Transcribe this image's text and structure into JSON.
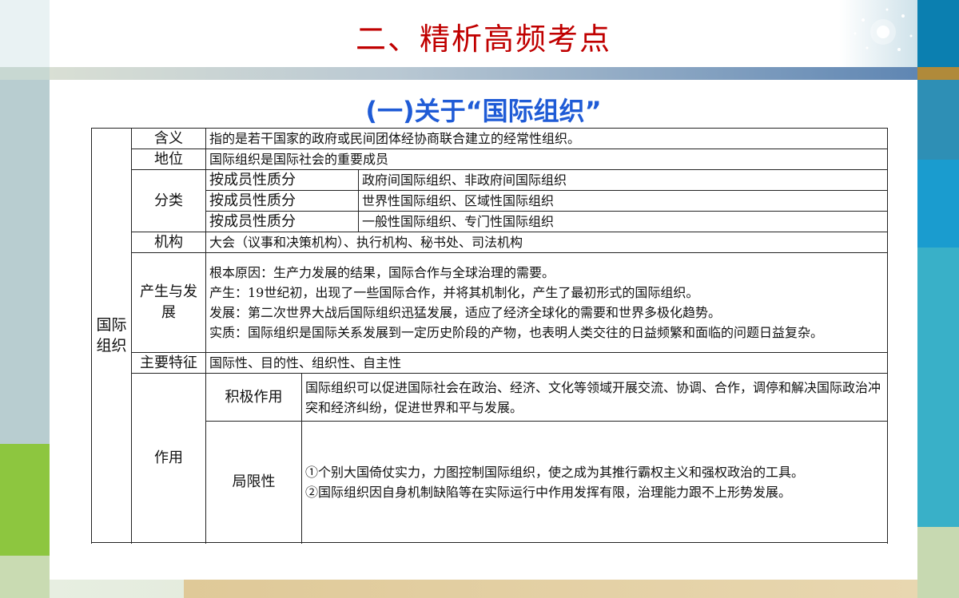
{
  "header": {
    "title": "二、精析高频考点",
    "subtitle": "(一)关于“国际组织”"
  },
  "table": {
    "group_label": "国际组织",
    "rows": {
      "hanyi": {
        "label": "含义",
        "content": "指的是若干国家的政府或民间团体经协商联合建立的经常性组织。"
      },
      "diwei": {
        "label": "地位",
        "content": "国际组织是国际社会的重要成员"
      },
      "fenlei": {
        "label": "分类",
        "items": [
          {
            "criterion": "按成员性质分",
            "content": "政府间国际组织、非政府间国际组织"
          },
          {
            "criterion": "按成员性质分",
            "content": "世界性国际组织、区域性国际组织"
          },
          {
            "criterion": "按成员性质分",
            "content": "一般性国际组织、专门性国际组织"
          }
        ]
      },
      "jigou": {
        "label": "机构",
        "content": "大会（议事和决策机构）、执行机构、秘书处、司法机构"
      },
      "chansheng": {
        "label": "产生与发展",
        "lines": [
          "根本原因：生产力发展的结果，国际合作与全球治理的需要。",
          "产生：19世纪初，出现了一些国际合作，并将其机制化，产生了最初形式的国际组织。",
          "发展：第二次世界大战后国际组织迅猛发展，适应了经济全球化的需要和世界多极化趋势。",
          "实质：国际组织是国际关系发展到一定历史阶段的产物，也表明人类交往的日益频繁和面临的问题日益复杂。"
        ]
      },
      "tezheng": {
        "label": "主要特征",
        "content": "国际性、目的性、组织性、自主性"
      },
      "zuoyong": {
        "label": "作用",
        "positive": {
          "label": "积极作用",
          "content": "国际组织可以促进国际社会在政治、经济、文化等领域开展交流、协调、合作，调停和解决国际政治冲突和经济纠纷，促进世界和平与发展。"
        },
        "limit": {
          "label": "局限性",
          "point1": "①个别大国倚仗实力，力图控制国际组织，使之成为其推行霸权主义和强权政治的工具。",
          "point2": "②国际组织因自身机制缺陷等在实际运行中作用发挥有限，治理能力跟不上形势发展。"
        }
      }
    }
  },
  "colors": {
    "title": "#c00000",
    "subtitle": "#1f5bd6"
  }
}
